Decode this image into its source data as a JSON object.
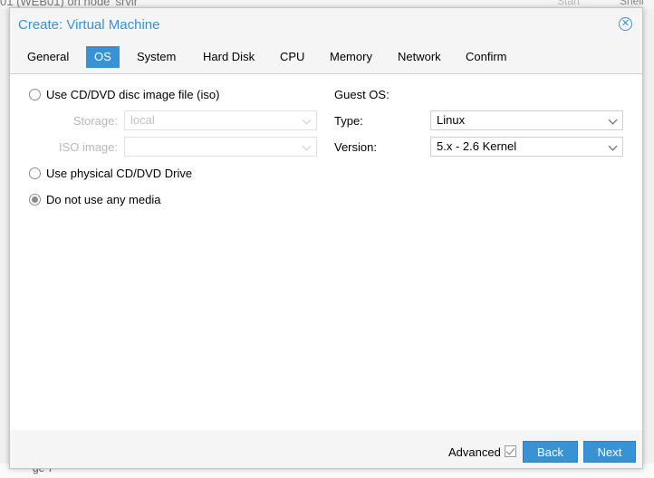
{
  "background": {
    "title_fragment": "01 (WEB01) on node 'srvlr'",
    "start_label": "Start",
    "shell_label": "Shell",
    "axis_fragment": "ge 7"
  },
  "dialog": {
    "title": "Create: Virtual Machine",
    "tabs": [
      "General",
      "OS",
      "System",
      "Hard Disk",
      "CPU",
      "Memory",
      "Network",
      "Confirm"
    ],
    "active_tab": "OS"
  },
  "media": {
    "iso_option": "Use CD/DVD disc image file (iso)",
    "storage_label": "Storage:",
    "storage_value": "local",
    "iso_image_label": "ISO image:",
    "iso_image_value": "",
    "physical_option": "Use physical CD/DVD Drive",
    "no_media_option": "Do not use any media",
    "selected": "no_media"
  },
  "guest_os": {
    "heading": "Guest OS:",
    "type_label": "Type:",
    "type_value": "Linux",
    "version_label": "Version:",
    "version_value": "5.x - 2.6 Kernel"
  },
  "footer": {
    "advanced_label": "Advanced",
    "advanced_checked": true,
    "back_label": "Back",
    "next_label": "Next"
  },
  "colors": {
    "accent": "#3892d4"
  }
}
